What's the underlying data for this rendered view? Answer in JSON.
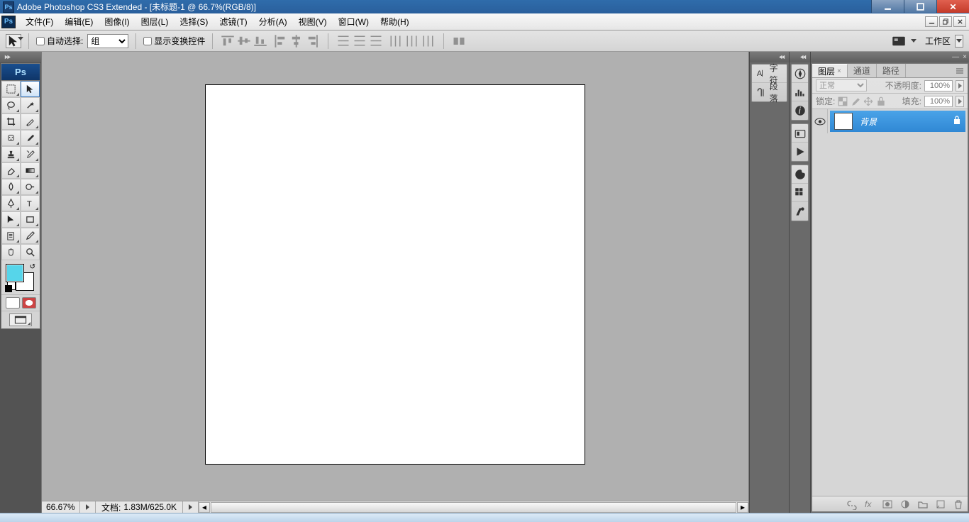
{
  "title": "Adobe Photoshop CS3 Extended - [未标题-1 @ 66.7%(RGB/8)]",
  "menu": {
    "file": "文件(F)",
    "edit": "编辑(E)",
    "image": "图像(I)",
    "layer": "图层(L)",
    "select": "选择(S)",
    "filter": "滤镜(T)",
    "analysis": "分析(A)",
    "view": "视图(V)",
    "window": "窗口(W)",
    "help": "帮助(H)"
  },
  "options": {
    "auto_select_label": "自动选择:",
    "group_label": "组",
    "show_transform_label": "显示变换控件",
    "workspace_label": "工作区"
  },
  "status": {
    "zoom": "66.67%",
    "doc_label": "文档:",
    "doc_value": "1.83M/625.0K"
  },
  "dock1": {
    "char": "字符",
    "para": "段落"
  },
  "layers_panel": {
    "tabs": {
      "layers": "图层",
      "channels": "通道",
      "paths": "路径"
    },
    "blend_mode": "正常",
    "opacity_label": "不透明度:",
    "opacity_value": "100%",
    "lock_label": "锁定:",
    "fill_label": "填充:",
    "fill_value": "100%",
    "layer_name": "背景"
  },
  "colors": {
    "fg": "#56d5ea",
    "bg": "#ffffff"
  }
}
